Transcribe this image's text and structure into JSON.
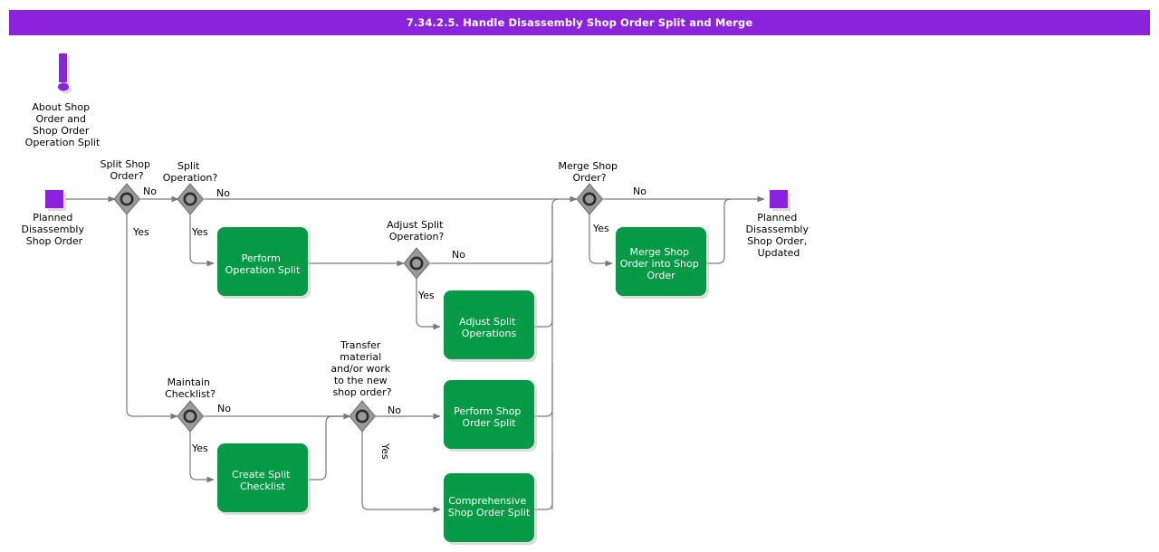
{
  "header": {
    "title": "7.34.2.5. Handle Disassembly Shop Order Split and Merge",
    "background_color": "#8A22DE",
    "text_color": "#ffffff"
  },
  "colors": {
    "task_green": "#059B46",
    "event_purple": "#8A22DE",
    "gateway_gray": "#9a9a9a",
    "flow_line": "#7a7a7a",
    "shadow": "#c8c8c8",
    "canvas": "#ffffff"
  },
  "annotation": {
    "icon": "exclamation-mark-icon",
    "label": "About Shop\nOrder and\nShop Order\nOperation Split",
    "lines": [
      "About Shop",
      "Order and",
      "Shop Order",
      "Operation Split"
    ]
  },
  "events": [
    {
      "id": "start-event",
      "type": "start",
      "label_lines": [
        "Planned",
        "Disassembly",
        "Shop Order"
      ],
      "label": "Planned Disassembly Shop Order"
    },
    {
      "id": "end-event",
      "type": "end",
      "label_lines": [
        "Planned",
        "Disassembly",
        "Shop Order,",
        "Updated"
      ],
      "label": "Planned Disassembly Shop Order, Updated"
    }
  ],
  "gateways": [
    {
      "id": "gw-split-shop-order",
      "label_lines": [
        "Split Shop",
        "Order?"
      ],
      "label": "Split Shop Order?",
      "outputs": [
        "No",
        "Yes"
      ]
    },
    {
      "id": "gw-split-operation",
      "label_lines": [
        "Split",
        "Operation?"
      ],
      "label": "Split Operation?",
      "outputs": [
        "No",
        "Yes"
      ]
    },
    {
      "id": "gw-adjust-split-operation",
      "label_lines": [
        "Adjust Split",
        "Operation?"
      ],
      "label": "Adjust Split Operation?",
      "outputs": [
        "No",
        "Yes"
      ]
    },
    {
      "id": "gw-merge-shop-order",
      "label_lines": [
        "Merge Shop",
        "Order?"
      ],
      "label": "Merge Shop Order?",
      "outputs": [
        "No",
        "Yes"
      ]
    },
    {
      "id": "gw-maintain-checklist",
      "label_lines": [
        "Maintain",
        "Checklist?"
      ],
      "label": "Maintain Checklist?",
      "outputs": [
        "No",
        "Yes"
      ]
    },
    {
      "id": "gw-transfer-material",
      "label_lines": [
        "Transfer",
        "material",
        "and/or work",
        "to the new",
        "shop order?"
      ],
      "label": "Transfer material and/or work to the new shop order?",
      "outputs": [
        "No",
        "Yes"
      ]
    }
  ],
  "tasks": [
    {
      "id": "task-perform-operation-split",
      "label_lines": [
        "Perform",
        "Operation Split"
      ],
      "label": "Perform Operation Split"
    },
    {
      "id": "task-adjust-split-operations",
      "label_lines": [
        "Adjust Split",
        "Operations"
      ],
      "label": "Adjust Split Operations"
    },
    {
      "id": "task-merge-shop-order-into-shop-order",
      "label_lines": [
        "Merge Shop",
        "Order into Shop",
        "Order"
      ],
      "label": "Merge Shop Order into Shop Order"
    },
    {
      "id": "task-create-split-checklist",
      "label_lines": [
        "Create Split",
        "Checklist"
      ],
      "label": "Create Split Checklist"
    },
    {
      "id": "task-perform-shop-order-split",
      "label_lines": [
        "Perform Shop",
        "Order Split"
      ],
      "label": "Perform Shop Order Split"
    },
    {
      "id": "task-comprehensive-shop-order-split",
      "label_lines": [
        "Comprehensive",
        "Shop Order Split"
      ],
      "label": "Comprehensive Shop Order Split"
    }
  ],
  "edge_labels": {
    "split_shop_order_no": "No",
    "split_shop_order_yes": "Yes",
    "split_operation_no": "No",
    "split_operation_yes": "Yes",
    "adjust_split_operation_no": "No",
    "adjust_split_operation_yes": "Yes",
    "merge_shop_order_no": "No",
    "merge_shop_order_yes": "Yes",
    "maintain_checklist_no": "No",
    "maintain_checklist_yes": "Yes",
    "transfer_material_no": "No",
    "transfer_material_yes": "Yes"
  }
}
